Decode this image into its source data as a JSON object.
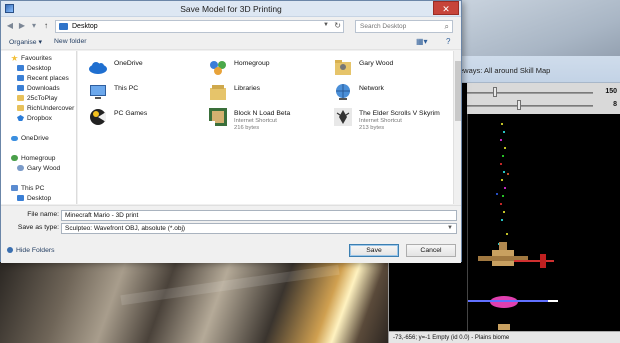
{
  "dialog": {
    "title": "Save Model for 3D Printing",
    "close_glyph": "✕",
    "address": {
      "path": "Desktop"
    },
    "search": {
      "placeholder": "Search Desktop"
    },
    "toolbar": {
      "organize": "Organise ▾",
      "new_folder": "New folder"
    },
    "nav": [
      {
        "label": "Favourites",
        "icon": "star"
      },
      {
        "label": "Desktop",
        "icon": "blue"
      },
      {
        "label": "Recent places",
        "icon": "blue"
      },
      {
        "label": "Downloads",
        "icon": "blue"
      },
      {
        "label": "25cToPlay",
        "icon": "yellow"
      },
      {
        "label": "RichUndercover",
        "icon": "yellow"
      },
      {
        "label": "Dropbox",
        "icon": "drop"
      },
      {
        "label": "OneDrive",
        "icon": "cloud"
      },
      {
        "label": "Homegroup",
        "icon": "group"
      },
      {
        "label": "Gary Wood",
        "icon": "user"
      },
      {
        "label": "This PC",
        "icon": "pc"
      },
      {
        "label": "Desktop",
        "icon": "blue"
      }
    ],
    "files": [
      {
        "name": "OneDrive",
        "sub1": "",
        "sub2": "",
        "icon": "cloud-icon"
      },
      {
        "name": "Homegroup",
        "sub1": "",
        "sub2": "",
        "icon": "homegroup-icon"
      },
      {
        "name": "Gary Wood",
        "sub1": "",
        "sub2": "",
        "icon": "user-folder-icon"
      },
      {
        "name": "This PC",
        "sub1": "",
        "sub2": "",
        "icon": "computer-icon"
      },
      {
        "name": "Libraries",
        "sub1": "",
        "sub2": "",
        "icon": "libraries-icon"
      },
      {
        "name": "Network",
        "sub1": "",
        "sub2": "",
        "icon": "network-icon"
      },
      {
        "name": "PC Games",
        "sub1": "",
        "sub2": "",
        "icon": "pc-games-icon"
      },
      {
        "name": "Block N Load Beta",
        "sub1": "Internet Shortcut",
        "sub2": "216 bytes",
        "icon": "game-shortcut-icon"
      },
      {
        "name": "The Elder Scrolls V Skyrim",
        "sub1": "Internet Shortcut",
        "sub2": "213 bytes",
        "icon": "skyrim-shortcut-icon"
      }
    ],
    "form": {
      "file_name_label": "File name:",
      "file_name_value": "Minecraft Mario - 3D print",
      "type_label": "Save as type:",
      "type_value": "Sculpteo: Wavefront OBJ, absolute (*.obj)",
      "save": "Save",
      "cancel": "Cancel",
      "hide_folders": "Hide Folders"
    }
  },
  "map_window": {
    "title": "eways: All around Skill Map",
    "slider1_value": "150",
    "slider1_level": 0.21,
    "slider2_value": "8",
    "slider2_level": 0.4,
    "status": "-73,-656; y=-1 Empty (id 0.0) - Plains biome"
  },
  "colors": {
    "accent": "#2f73c9",
    "title_bar": "#dde7f3",
    "close": "#c7443a",
    "map_bg": "#000000"
  }
}
